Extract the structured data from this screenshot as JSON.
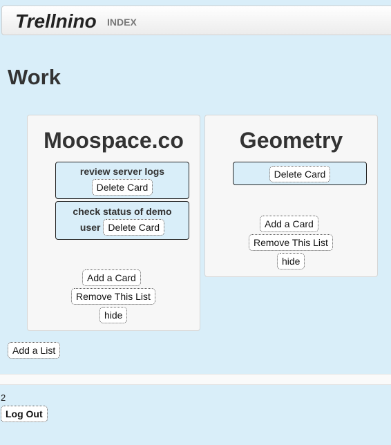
{
  "nav": {
    "brand": "Trellnino",
    "index_link": "INDEX"
  },
  "board": {
    "title": "Work"
  },
  "lists": [
    {
      "title": "Moospace.co",
      "cards": [
        {
          "text": "review server logs",
          "delete_label": "Delete Card"
        },
        {
          "text_line1": "check status of demo",
          "text_line2": "user",
          "delete_label": "Delete Card"
        }
      ],
      "add_card_label": "Add a Card",
      "remove_list_label": "Remove This List",
      "hide_label": "hide"
    },
    {
      "title": "Geometry",
      "cards": [
        {
          "text": "",
          "delete_label": "Delete Card"
        }
      ],
      "add_card_label": "Add a Card",
      "remove_list_label": "Remove This List",
      "hide_label": "hide"
    }
  ],
  "add_list_label": "Add a List",
  "footer": {
    "count": "2",
    "logout_label": "Log Out"
  }
}
